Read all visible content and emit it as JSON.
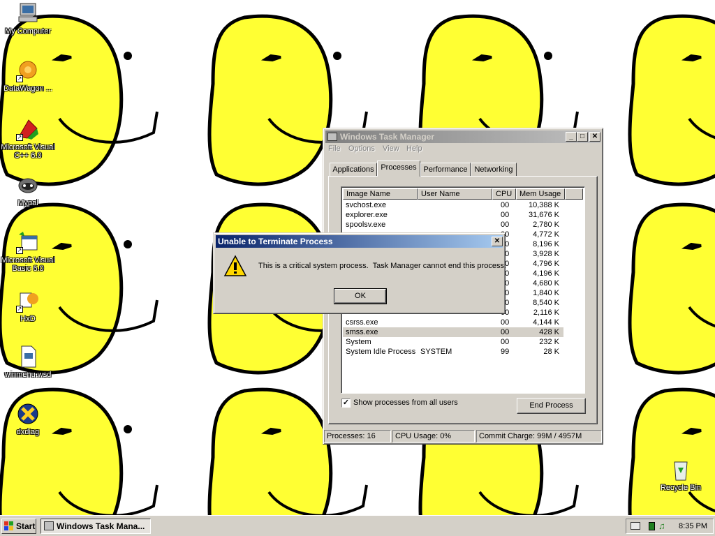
{
  "desktop": {
    "icons": [
      {
        "label": "My Computer",
        "icon": "my-computer-icon"
      },
      {
        "label": "DataWagon ...",
        "icon": "datawagon-icon"
      },
      {
        "label": "Microsoft Visual C++ 6.0",
        "icon": "visual-cpp-icon"
      },
      {
        "label": "Mypal",
        "icon": "mypal-icon"
      },
      {
        "label": "Microsoft Visual Basic 6.0",
        "icon": "visual-basic-icon"
      },
      {
        "label": "HxD",
        "icon": "hxd-icon"
      },
      {
        "label": "winmenu.wsd",
        "icon": "document-icon"
      },
      {
        "label": "dxdiag",
        "icon": "dxdiag-icon"
      },
      {
        "label": "Recycle Bin",
        "icon": "recycle-bin-icon"
      }
    ],
    "wallpaper_colors": {
      "face": "#ffff33",
      "outline": "#000000"
    }
  },
  "task_manager": {
    "title": "Windows Task Manager",
    "menu": [
      "File",
      "Options",
      "View",
      "Help"
    ],
    "tabs": [
      "Applications",
      "Processes",
      "Performance",
      "Networking"
    ],
    "selected_tab": "Processes",
    "columns": [
      "Image Name",
      "User Name",
      "CPU",
      "Mem Usage"
    ],
    "rows": [
      {
        "name": "svchost.exe",
        "user": "",
        "cpu": "00",
        "mem": "10,388 K"
      },
      {
        "name": "explorer.exe",
        "user": "",
        "cpu": "00",
        "mem": "31,676 K"
      },
      {
        "name": "spoolsv.exe",
        "user": "",
        "cpu": "00",
        "mem": "2,780 K"
      },
      {
        "name": "",
        "user": "",
        "cpu": "00",
        "mem": "4,772 K"
      },
      {
        "name": "",
        "user": "",
        "cpu": "00",
        "mem": "8,196 K"
      },
      {
        "name": "",
        "user": "",
        "cpu": "00",
        "mem": "3,928 K"
      },
      {
        "name": "",
        "user": "",
        "cpu": "00",
        "mem": "4,796 K"
      },
      {
        "name": "",
        "user": "",
        "cpu": "00",
        "mem": "4,196 K"
      },
      {
        "name": "",
        "user": "",
        "cpu": "00",
        "mem": "4,680 K"
      },
      {
        "name": "",
        "user": "",
        "cpu": "00",
        "mem": "1,840 K"
      },
      {
        "name": "",
        "user": "",
        "cpu": "00",
        "mem": "8,540 K"
      },
      {
        "name": "",
        "user": "",
        "cpu": "00",
        "mem": "2,116 K"
      },
      {
        "name": "csrss.exe",
        "user": "",
        "cpu": "00",
        "mem": "4,144 K"
      },
      {
        "name": "smss.exe",
        "user": "",
        "cpu": "00",
        "mem": "428 K"
      },
      {
        "name": "System",
        "user": "",
        "cpu": "00",
        "mem": "232 K"
      },
      {
        "name": "System Idle Process",
        "user": "SYSTEM",
        "cpu": "99",
        "mem": "28 K"
      }
    ],
    "selected_row": "smss.exe",
    "show_all_label": "Show processes from all users",
    "show_all_checked": true,
    "end_process_label": "End Process",
    "status": {
      "processes": "Processes: 16",
      "cpu": "CPU Usage: 0%",
      "commit": "Commit Charge: 99M / 4957M"
    }
  },
  "dialog": {
    "title": "Unable to Terminate Process",
    "message": "This is a critical system process.  Task Manager cannot end this process.",
    "ok_label": "OK",
    "icon": "warning-icon"
  },
  "taskbar": {
    "start_label": "Start",
    "task_label": "Windows Task Mana...",
    "clock": "8:35 PM"
  }
}
